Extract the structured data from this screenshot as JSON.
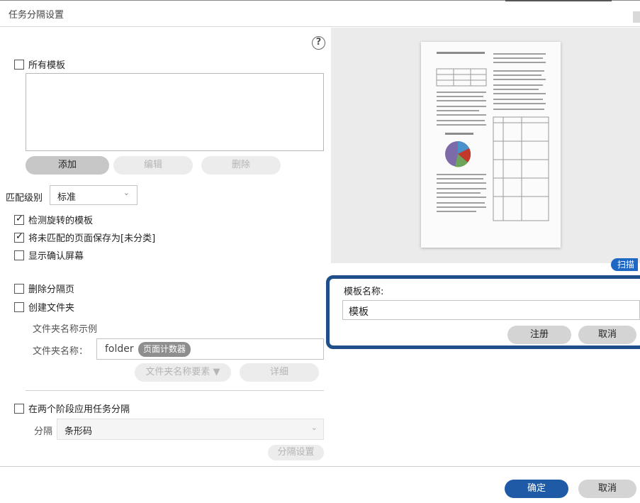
{
  "window": {
    "title": "任务分隔设置"
  },
  "templates": {
    "all_templates_label": "所有模板",
    "all_templates_checked": false,
    "add_label": "添加",
    "edit_label": "编辑",
    "delete_label": "删除"
  },
  "match_level": {
    "label": "匹配级别",
    "value": "标准"
  },
  "options": {
    "detect_rotated": {
      "label": "检测旋转的模板",
      "checked": true
    },
    "save_unmatched": {
      "label": "将未匹配的页面保存为[未分类]",
      "checked": true
    },
    "show_confirm": {
      "label": "显示确认屏幕",
      "checked": false
    },
    "delete_separator": {
      "label": "删除分隔页",
      "checked": false
    },
    "create_folder": {
      "label": "创建文件夹",
      "checked": false
    }
  },
  "folder": {
    "example_label": "文件夹名称示例",
    "name_label": "文件夹名称：",
    "name_prefix": "folder",
    "name_chip": "页面计数器",
    "element_button": "文件夹名称要素 ▼",
    "detail_button": "详细"
  },
  "two_stage": {
    "label": "在两个阶段应用任务分隔",
    "checked": false,
    "separator_label": "分隔",
    "separator_value": "条形码",
    "settings_button": "分隔设置"
  },
  "right": {
    "scan_button": "扫描",
    "template_name_label": "模板名称:",
    "template_name_value": "模板",
    "register_button": "注册",
    "cancel_button": "取消"
  },
  "footer": {
    "ok_button": "确定",
    "cancel_button": "取消"
  },
  "icons": {
    "help": "?",
    "chevron": "⌄"
  },
  "colors": {
    "accent": "#1f5aa6",
    "highlight_frame": "#1f4f8a",
    "scan": "#1f67c4"
  }
}
